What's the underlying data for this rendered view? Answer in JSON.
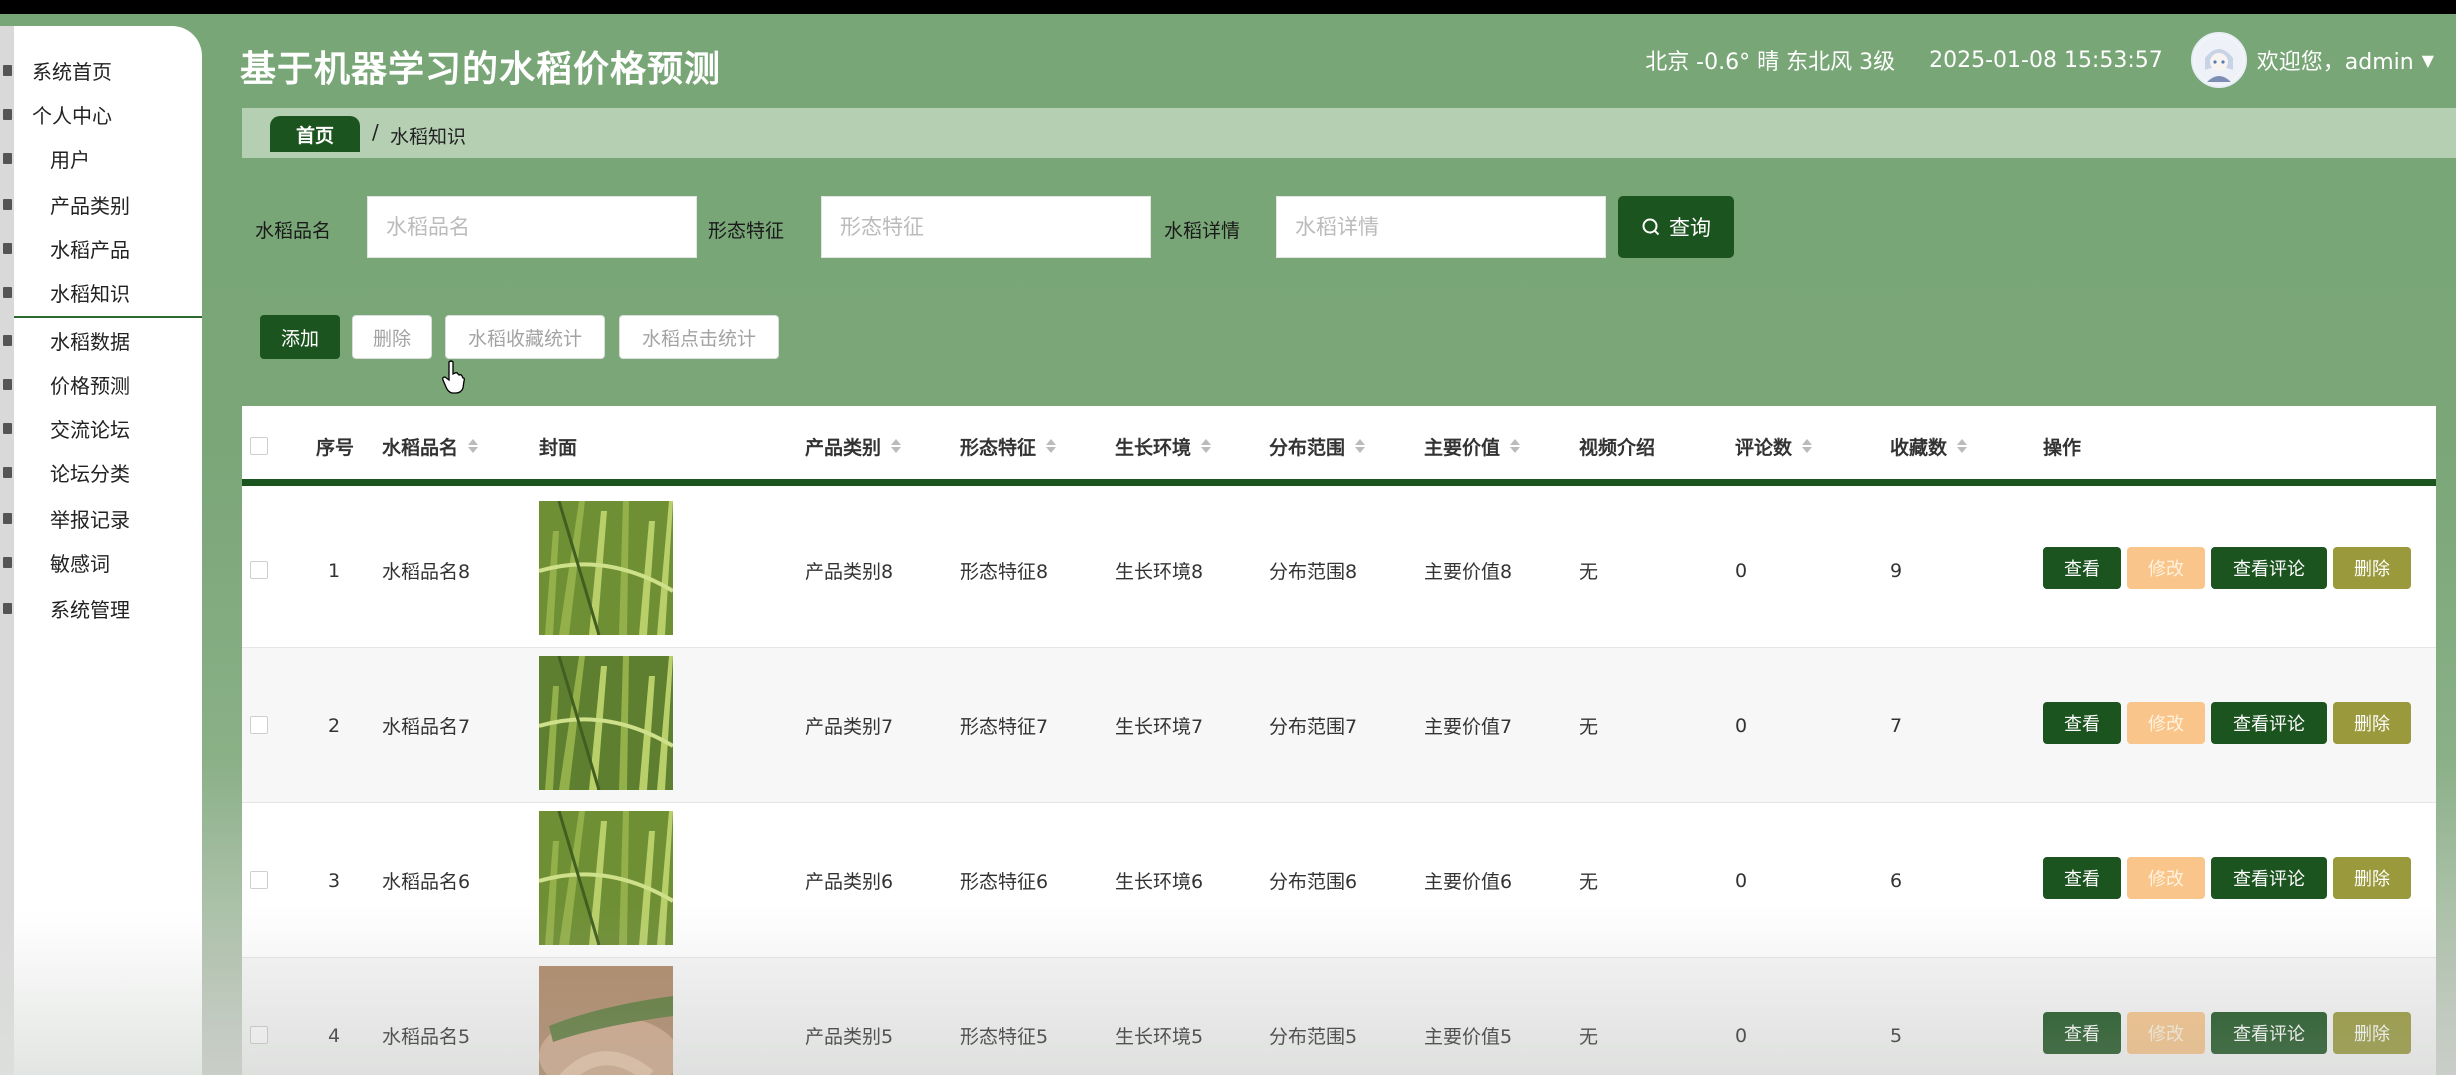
{
  "app": {
    "title": "基于机器学习的水稻价格预测",
    "weather": "北京  -0.6°  晴  东北风  3级",
    "datetime": "2025-01-08 15:53:57",
    "welcome": "欢迎您，admin",
    "caret": "▼"
  },
  "sidebar": {
    "items": [
      {
        "label": "系统首页",
        "level": "top",
        "icon": "home-icon"
      },
      {
        "label": "个人中心",
        "level": "top",
        "icon": "user-center-icon"
      },
      {
        "label": "用户",
        "level": "sub",
        "icon": "grid-icon"
      },
      {
        "label": "产品类别",
        "level": "sub",
        "icon": "person-icon"
      },
      {
        "label": "水稻产品",
        "level": "sub",
        "icon": "doc-icon"
      },
      {
        "label": "水稻知识",
        "level": "sub",
        "icon": "file-icon",
        "active": true
      },
      {
        "label": "水稻数据",
        "level": "sub",
        "icon": "chat-icon"
      },
      {
        "label": "价格预测",
        "level": "sub",
        "icon": "edit-icon"
      },
      {
        "label": "交流论坛",
        "level": "sub",
        "icon": "grid-icon"
      },
      {
        "label": "论坛分类",
        "level": "sub",
        "icon": "close-box-icon"
      },
      {
        "label": "举报记录",
        "level": "sub",
        "icon": "bar-chart-icon"
      },
      {
        "label": "敏感词",
        "level": "sub",
        "icon": "check-box-icon"
      },
      {
        "label": "系统管理",
        "level": "sub",
        "icon": "grid-icon"
      }
    ]
  },
  "breadcrumb": {
    "home": "首页",
    "separator": "/",
    "current": "水稻知识"
  },
  "search": {
    "fields": [
      {
        "label": "水稻品名",
        "placeholder": "水稻品名"
      },
      {
        "label": "形态特征",
        "placeholder": "形态特征"
      },
      {
        "label": "水稻详情",
        "placeholder": "水稻详情"
      }
    ],
    "query_label": "查询"
  },
  "actions": {
    "add": "添加",
    "delete": "删除",
    "fav_stats": "水稻收藏统计",
    "click_stats": "水稻点击统计"
  },
  "table": {
    "headers": [
      "序号",
      "水稻品名",
      "封面",
      "产品类别",
      "形态特征",
      "生长环境",
      "分布范围",
      "主要价值",
      "视频介绍",
      "评论数",
      "收藏数",
      "操作"
    ],
    "rows": [
      {
        "no": "1",
        "name": "水稻品名8",
        "category": "产品类别8",
        "morph": "形态特征8",
        "env": "生长环境8",
        "range": "分布范围8",
        "value": "主要价值8",
        "video": "无",
        "comments": "0",
        "favs": "9"
      },
      {
        "no": "2",
        "name": "水稻品名7",
        "category": "产品类别7",
        "morph": "形态特征7",
        "env": "生长环境7",
        "range": "分布范围7",
        "value": "主要价值7",
        "video": "无",
        "comments": "0",
        "favs": "7"
      },
      {
        "no": "3",
        "name": "水稻品名6",
        "category": "产品类别6",
        "morph": "形态特征6",
        "env": "生长环境6",
        "range": "分布范围6",
        "value": "主要价值6",
        "video": "无",
        "comments": "0",
        "favs": "6"
      },
      {
        "no": "4",
        "name": "水稻品名5",
        "category": "产品类别5",
        "morph": "形态特征5",
        "env": "生长环境5",
        "range": "分布范围5",
        "value": "主要价值5",
        "video": "无",
        "comments": "0",
        "favs": "5"
      }
    ],
    "row_actions": {
      "view": "查看",
      "edit": "修改",
      "comments": "查看评论",
      "delete": "删除"
    }
  },
  "colors": {
    "primary": "#1c5420",
    "edit": "#f9c58a",
    "delete": "#9a9a3c",
    "header_bg": "#78a676"
  }
}
